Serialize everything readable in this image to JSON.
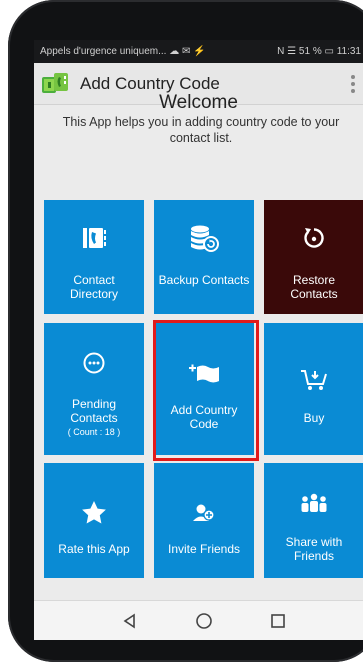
{
  "status_bar": {
    "left_text": "Appels d'urgence uniquem... ☁ ✉ ⚡",
    "right_text": "N ☰ 51 % ▭ 11:31"
  },
  "app_bar": {
    "title": "Add Country Code"
  },
  "welcome": {
    "title": "Welcome",
    "subtitle": "This App helps you in adding country code to your contact list."
  },
  "tiles": [
    {
      "label": "Contact Directory",
      "icon": "contact-directory-icon"
    },
    {
      "label": "Backup Contacts",
      "icon": "backup-database-icon"
    },
    {
      "label": "Restore Contacts",
      "icon": "restore-icon"
    },
    {
      "label": "Pending Contacts",
      "sub": "( Count : 18 )",
      "icon": "pending-dots-icon"
    },
    {
      "label": "Add Country Code",
      "icon": "flag-plus-icon"
    },
    {
      "label": "Buy",
      "icon": "cart-icon"
    },
    {
      "label": "Rate this App",
      "icon": "star-icon"
    },
    {
      "label": "Invite Friends",
      "icon": "invite-user-icon"
    },
    {
      "label": "Share with Friends",
      "icon": "group-share-icon"
    }
  ],
  "colors": {
    "tile_blue": "#0a8bd4",
    "tile_dark": "#3a0909",
    "highlight_red": "#e11b1b"
  }
}
